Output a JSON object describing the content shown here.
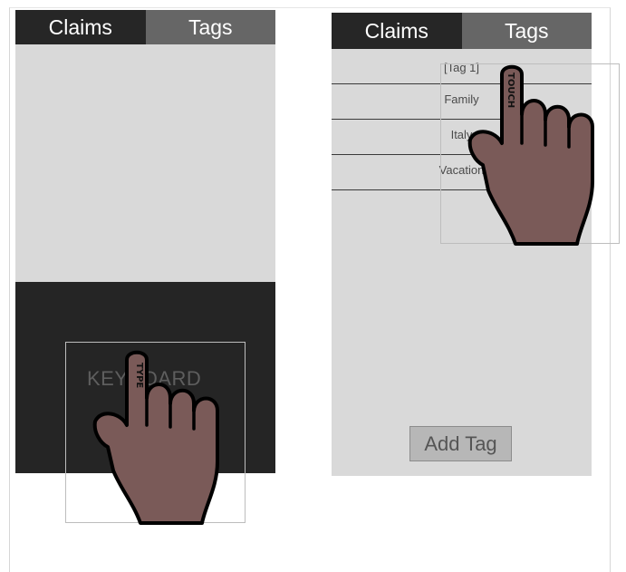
{
  "left_screen": {
    "tabs": [
      {
        "label": "Claims",
        "active": true
      },
      {
        "label": "Tags",
        "active": false
      }
    ],
    "keyboard_label": "KEYBOARD",
    "gesture_label": "TYPE"
  },
  "right_screen": {
    "tabs": [
      {
        "label": "Claims",
        "active": true
      },
      {
        "label": "Tags",
        "active": false
      }
    ],
    "tags": [
      {
        "label": "[Tag 1]"
      },
      {
        "label": "Family"
      },
      {
        "label": "Italy"
      },
      {
        "label": "Vacation"
      }
    ],
    "add_tag_label": "Add Tag",
    "gesture_label": "TOUCH"
  },
  "colors": {
    "screen_background": "#d9d9d9",
    "active_tab": "#262626",
    "inactive_tab": "#666666",
    "keyboard": "#252525",
    "hand_fill": "#7a5a58",
    "add_tag_button": "#b7b7b7"
  },
  "icons": {
    "gesture_hand": "pointing-hand-icon"
  }
}
